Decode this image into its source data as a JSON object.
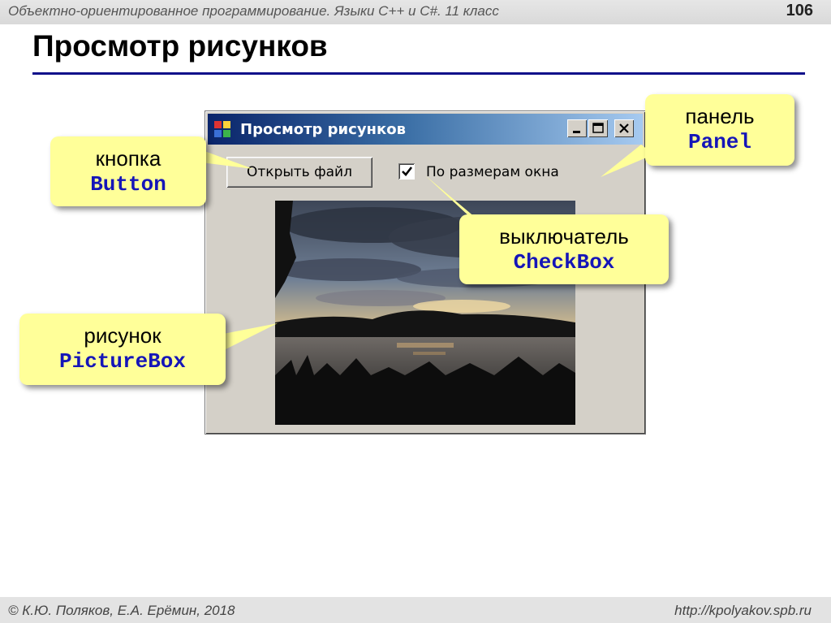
{
  "header": {
    "course": "Объектно-ориентированное программирование. Языки C++ и C#. 11 класс",
    "page_number": "106",
    "title": "Просмотр рисунков"
  },
  "window": {
    "title": "Просмотр рисунков",
    "min_icon": "minimize-icon",
    "max_icon": "maximize-icon",
    "close_icon": "close-icon",
    "open_button_label": "Открыть файл",
    "checkbox_label": "По размерам окна",
    "checkbox_checked": true,
    "picture_icon": "landscape-photo"
  },
  "callouts": {
    "button": {
      "ru": "кнопка",
      "en": "Button"
    },
    "panel": {
      "ru": "панель",
      "en": "Panel"
    },
    "checkbox": {
      "ru": "выключатель",
      "en": "CheckBox"
    },
    "picturebox": {
      "ru": "рисунок",
      "en": "PictureBox"
    }
  },
  "footer": {
    "left": "© К.Ю. Поляков, Е.А. Ерёмин, 2018",
    "right": "http://kpolyakov.spb.ru"
  },
  "colors": {
    "title_rule": "#10108a",
    "callout_bg": "#ffff99",
    "class_name": "#1515b8"
  }
}
